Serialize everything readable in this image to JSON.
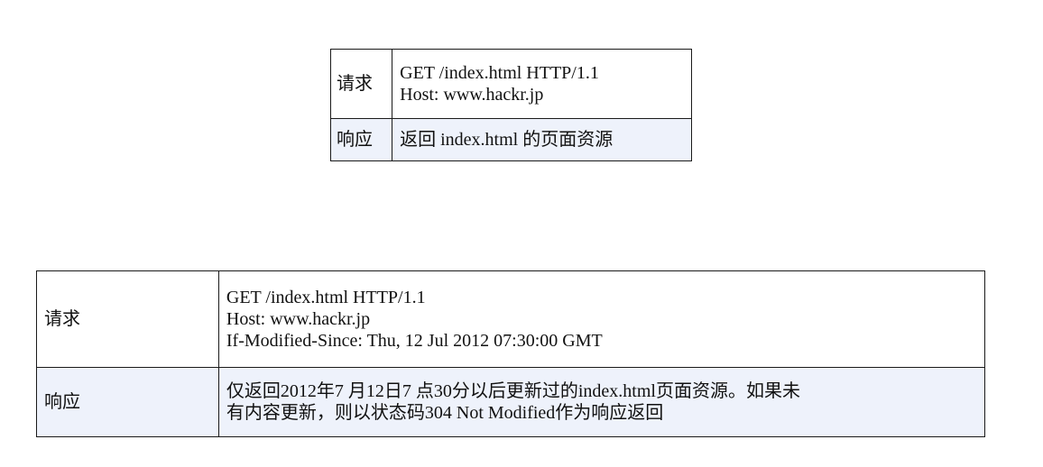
{
  "table1": {
    "request_label": "请求",
    "request_lines": [
      "GET /index.html HTTP/1.1",
      "Host: www.hackr.jp"
    ],
    "response_label": "响应",
    "response_text": "返回 index.html 的页面资源"
  },
  "table2": {
    "request_label": "请求",
    "request_lines": [
      "GET /index.html HTTP/1.1",
      "Host: www.hackr.jp",
      "If-Modified-Since: Thu, 12 Jul 2012 07:30:00 GMT"
    ],
    "response_label": "响应",
    "response_lines": [
      "仅返回2012年7 月12日7 点30分以后更新过的index.html页面资源。如果未",
      "有内容更新，则以状态码304 Not Modified作为响应返回"
    ]
  }
}
